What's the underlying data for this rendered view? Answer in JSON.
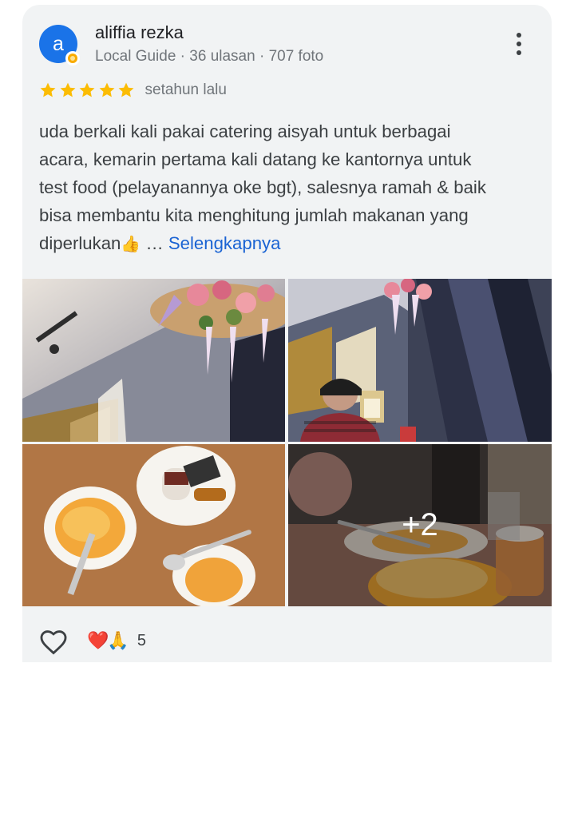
{
  "review": {
    "author": {
      "name": "aliffia rezka",
      "avatar_letter": "a",
      "meta": "Local Guide · 36 ulasan · 707 foto"
    },
    "rating": 5,
    "rating_max": 5,
    "date": "setahun lalu",
    "text_lines": [
      "uda berkali kali pakai catering aisyah untuk berbagai",
      "acara, kemarin pertama kali datang ke kantornya untuk",
      "test food (pelayanannya oke bgt), salesnya ramah & baik",
      "bisa membantu kita menghitung jumlah makanan yang",
      "diperlukan"
    ],
    "text_emoji": "👍",
    "ellipsis": " … ",
    "more_label": "Selengkapnya",
    "photos": [
      {
        "icon": "venue-decor-photo"
      },
      {
        "icon": "venue-guest-photo"
      },
      {
        "icon": "food-plates-photo"
      },
      {
        "icon": "dessert-photo"
      }
    ],
    "more_photos_label": "+2",
    "reactions": {
      "heart": "❤️",
      "pray": "🙏",
      "count": "5"
    }
  },
  "colors": {
    "card_bg": "#f1f3f4",
    "avatar": "#1a73e8",
    "star": "#fbbc04",
    "link": "#1a63d3",
    "text": "#3c4043",
    "secondary": "#70757a"
  }
}
